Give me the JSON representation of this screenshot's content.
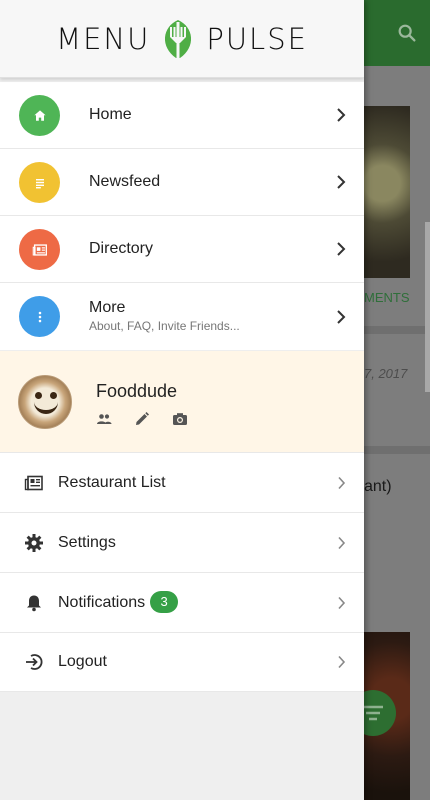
{
  "app": {
    "brand_left": "MENU",
    "brand_right": "PULSE"
  },
  "colors": {
    "home": "#4fb556",
    "newsfeed": "#f1c232",
    "directory": "#ee6a45",
    "more": "#3f9de8",
    "badge": "#35a046",
    "profile_bg": "#fff6e7"
  },
  "nav": {
    "items": [
      {
        "label": "Home",
        "sub": "",
        "icon": "home-icon"
      },
      {
        "label": "Newsfeed",
        "sub": "",
        "icon": "list-icon"
      },
      {
        "label": "Directory",
        "sub": "",
        "icon": "newspaper-icon"
      },
      {
        "label": "More",
        "sub": "About, FAQ, Invite Friends...",
        "icon": "more-vertical-icon"
      }
    ]
  },
  "profile": {
    "name": "Fooddude",
    "actions": [
      "friends-icon",
      "edit-icon",
      "camera-icon"
    ]
  },
  "menu": {
    "items": [
      {
        "label": "Restaurant List",
        "icon": "newspaper-icon"
      },
      {
        "label": "Settings",
        "icon": "gear-icon"
      },
      {
        "label": "Notifications",
        "icon": "bell-icon",
        "badge": "3"
      },
      {
        "label": "Logout",
        "icon": "logout-icon"
      }
    ]
  },
  "background": {
    "comments_fragment": "MENTS",
    "date_fragment": "7, 2017",
    "text_fragment": "ant)"
  }
}
